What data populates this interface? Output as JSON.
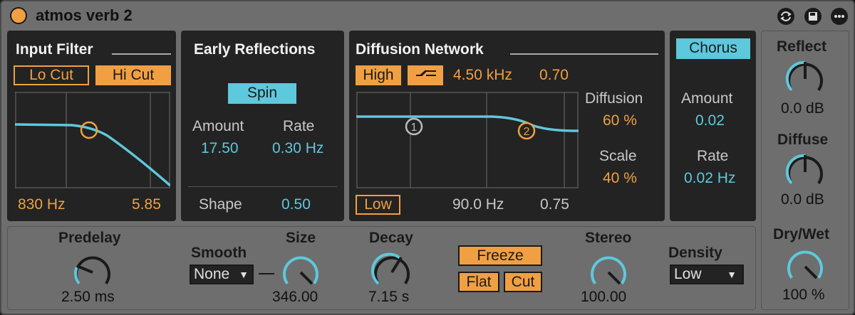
{
  "header": {
    "device_name": "atmos verb 2",
    "icons": [
      "hot-swap-icon",
      "save-preset-icon",
      "more-options-icon"
    ]
  },
  "input_filter": {
    "title": "Input Filter",
    "lo_cut": "Lo Cut",
    "hi_cut": "Hi Cut",
    "freq": "830 Hz",
    "res": "5.85"
  },
  "early_reflections": {
    "title": "Early Reflections",
    "spin": "Spin",
    "amount_label": "Amount",
    "amount_value": "17.50",
    "rate_label": "Rate",
    "rate_value": "0.30 Hz",
    "shape_label": "Shape",
    "shape_value": "0.50"
  },
  "diffusion_network": {
    "title": "Diffusion Network",
    "high_label": "High",
    "high_freq": "4.50 kHz",
    "high_value": "0.70",
    "low_label": "Low",
    "low_freq": "90.0 Hz",
    "low_value": "0.75",
    "point_1": "1",
    "point_2": "2",
    "diffusion_label": "Diffusion",
    "diffusion_value": "60 %",
    "scale_label": "Scale",
    "scale_value": "40 %"
  },
  "chorus": {
    "button": "Chorus",
    "amount_label": "Amount",
    "amount_value": "0.02",
    "rate_label": "Rate",
    "rate_value": "0.02 Hz"
  },
  "output": {
    "reflect_label": "Reflect",
    "reflect_value": "0.0 dB",
    "diffuse_label": "Diffuse",
    "diffuse_value": "0.0 dB",
    "drywet_label": "Dry/Wet",
    "drywet_value": "100 %"
  },
  "global": {
    "predelay_label": "Predelay",
    "predelay_value": "2.50 ms",
    "smooth_label": "Smooth",
    "smooth_value": "None",
    "size_label": "Size",
    "size_value": "346.00",
    "decay_label": "Decay",
    "decay_value": "7.15 s",
    "freeze": "Freeze",
    "flat": "Flat",
    "cut": "Cut",
    "stereo_label": "Stereo",
    "stereo_value": "100.00",
    "density_label": "Density",
    "density_value": "Low"
  },
  "colors": {
    "accent_orange": "#f0a042",
    "accent_blue": "#5ec8dc",
    "panel_dark": "#232323",
    "device_grey": "#6e6e6e"
  }
}
